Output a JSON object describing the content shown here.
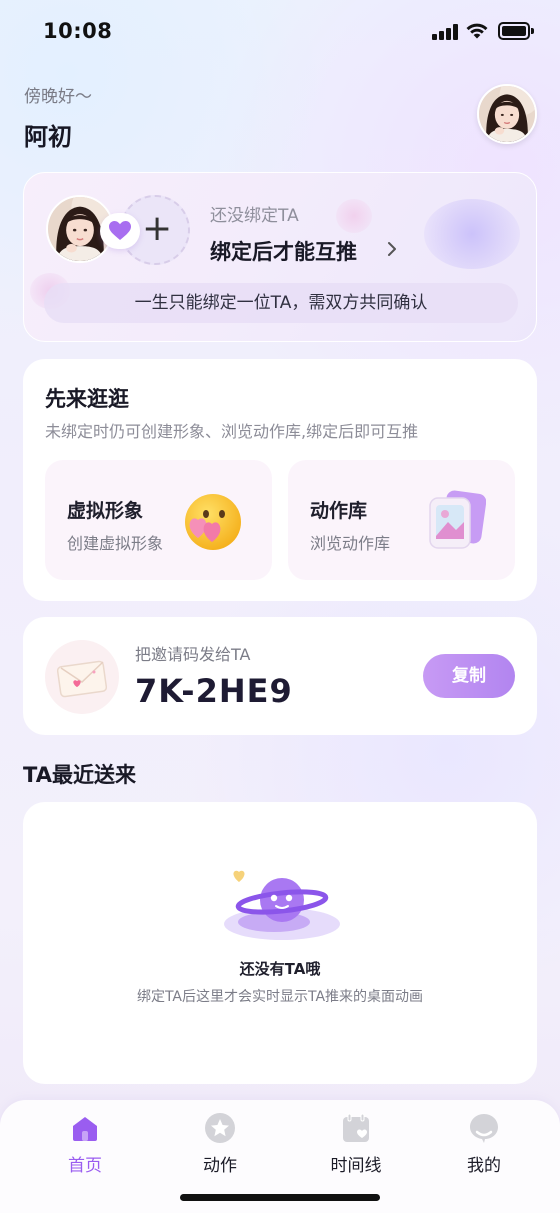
{
  "status_bar": {
    "time": "10:08"
  },
  "header": {
    "greeting": "傍晚好～",
    "username": "阿初"
  },
  "bind_card": {
    "subtitle": "还没绑定TA",
    "title": "绑定后才能互推",
    "note": "一生只能绑定一位TA，需双方共同确认"
  },
  "explore": {
    "title": "先来逛逛",
    "description": "未绑定时仍可创建形象、浏览动作库,绑定后即可互推",
    "tiles": [
      {
        "title": "虚拟形象",
        "subtitle": "创建虚拟形象",
        "icon": "emoji-icon"
      },
      {
        "title": "动作库",
        "subtitle": "浏览动作库",
        "icon": "gallery-icon"
      }
    ]
  },
  "invite": {
    "label": "把邀请码发给TA",
    "code": "7K-2HE9",
    "copy_label": "复制"
  },
  "recent": {
    "section_title": "TA最近送来",
    "empty_title": "还没有TA哦",
    "empty_desc": "绑定TA后这里才会实时显示TA推来的桌面动画"
  },
  "tab_bar": {
    "tabs": [
      {
        "label": "首页",
        "icon": "home-icon",
        "active": true
      },
      {
        "label": "动作",
        "icon": "star-icon",
        "active": false
      },
      {
        "label": "时间线",
        "icon": "calendar-heart-icon",
        "active": false
      },
      {
        "label": "我的",
        "icon": "profile-chat-icon",
        "active": false
      }
    ]
  },
  "colors": {
    "accent": "#9a5df0",
    "copy_button": "#bb8cf2",
    "bind_card_bg": "#f3ecfb"
  }
}
